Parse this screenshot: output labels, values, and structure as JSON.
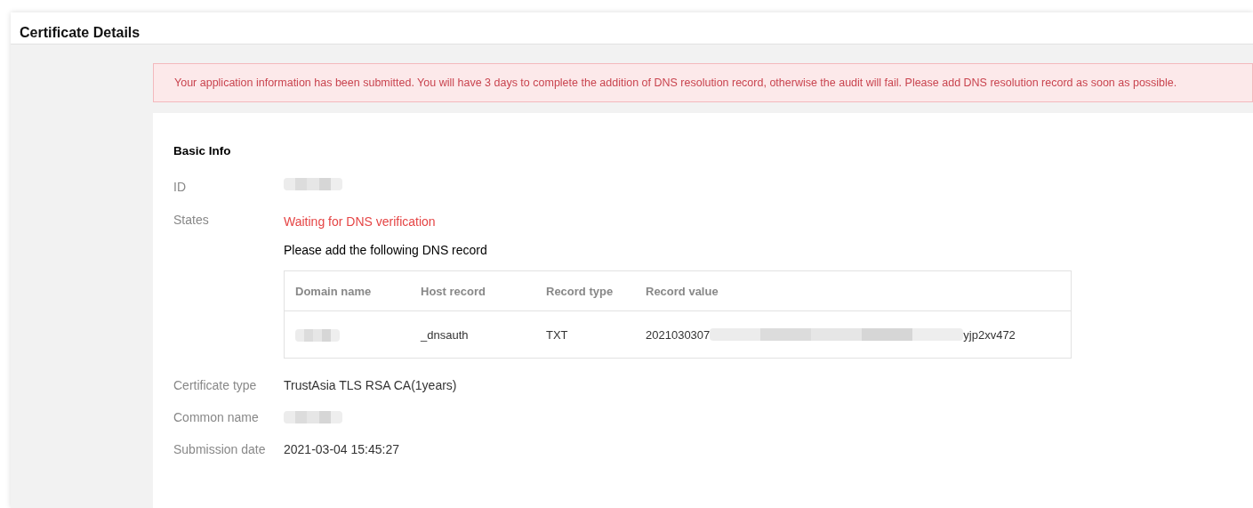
{
  "page": {
    "title": "Certificate Details"
  },
  "alert": {
    "text": "Your application information has been submitted. You will have 3 days to complete the addition of DNS resolution record, otherwise the audit will fail. Please add DNS resolution record as soon as possible."
  },
  "basic_info": {
    "title": "Basic Info",
    "fields_top": [
      {
        "label": "ID",
        "kind": "redacted"
      },
      {
        "label": "States",
        "kind": "status",
        "status": "Waiting for DNS verification",
        "hint": "Please add the following DNS record"
      }
    ],
    "dns_table": {
      "columns": [
        "Domain name",
        "Host record",
        "Record type",
        "Record value"
      ],
      "rows": [
        {
          "domain_name": {
            "kind": "redacted"
          },
          "host_record": "_dnsauth",
          "record_type": "TXT",
          "record_value": {
            "prefix": "2021030307",
            "suffix": "yjp2xv472"
          }
        }
      ]
    },
    "fields_bottom": [
      {
        "label": "Certificate type",
        "kind": "text",
        "value": "TrustAsia TLS RSA CA(1years)"
      },
      {
        "label": "Common name",
        "kind": "redacted"
      },
      {
        "label": "Submission date",
        "kind": "text",
        "value": "2021-03-04 15:45:27"
      }
    ]
  }
}
